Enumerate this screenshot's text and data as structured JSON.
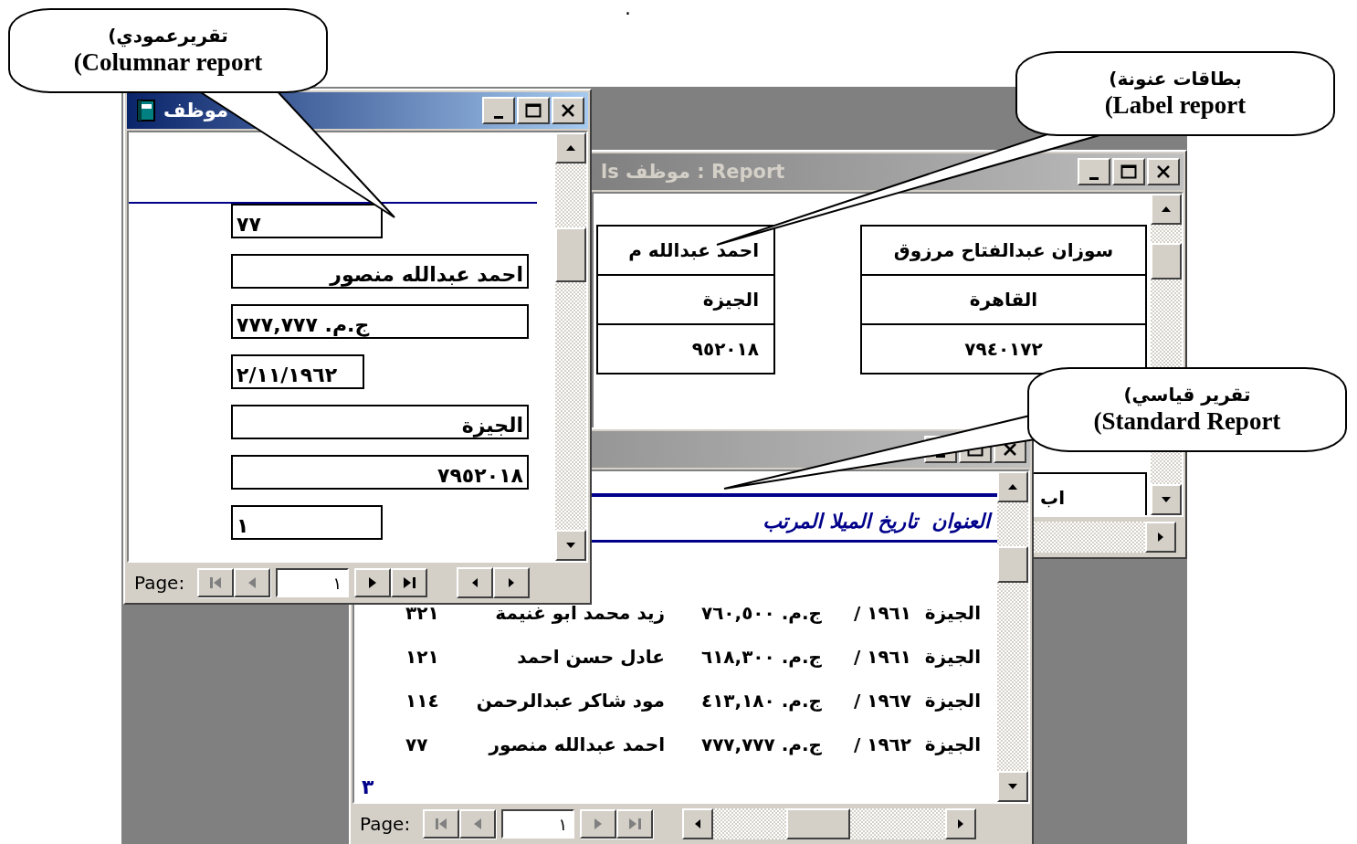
{
  "top_mark": ".",
  "callouts": [
    {
      "arabic": "(تقريرعمودي",
      "english": "(Columnar report"
    },
    {
      "arabic": "(بطاقات عنونة",
      "english": "(Label report"
    },
    {
      "arabic": "(تقرير قياسي",
      "english": "(Standard Report"
    }
  ],
  "columnar_report": {
    "title": "موظف",
    "fields": [
      "٧٧",
      "احمد عبدالله منصور",
      "ج.م. ٧٧٧,٧٧٧",
      "٢/١١/١٩٦٢",
      "الجيزة",
      "٧٩٥٢٠١٨",
      "١"
    ],
    "page_label": "Page:",
    "page_number": "١",
    "nav": [
      {
        "kind": "first",
        "disabled": true
      },
      {
        "kind": "previous",
        "disabled": true
      },
      {
        "kind": "next",
        "disabled": false
      },
      {
        "kind": "last",
        "disabled": false
      }
    ]
  },
  "label_report": {
    "title": "ls موظف : Report",
    "cards": [
      {
        "lines": [
          "سوزان عبدالفتاح مرزوق",
          "القاهرة",
          "٧٩٤٠١٧٢"
        ]
      },
      {
        "lines": [
          "احمد عبدالله م",
          "الجيزة",
          "٩٥٢٠١٨"
        ]
      },
      {
        "lines": [
          "اب"
        ]
      }
    ]
  },
  "standard_report": {
    "header": "العنوان  تاريخ الميلا المرتب",
    "rows": [
      {
        "cells": [
          "الجيزة",
          "١٩٦١ /",
          "ج.م. ٧٦٠,٥٠٠",
          "زيد محمد ابو غنيمة",
          "٣٢١"
        ]
      },
      {
        "cells": [
          "الجيزة",
          "١٩٦١ /",
          "ج.م. ٦١٨,٣٠٠",
          "عادل حسن احمد",
          "١٢١"
        ]
      },
      {
        "cells": [
          "الجيزة",
          "١٩٦٧ /",
          "ج.م. ٤١٣,١٨٠",
          "مود شاكر عبدالرحمن",
          "١١٤"
        ]
      },
      {
        "cells": [
          "الجيزة",
          "١٩٦٢ /",
          "ج.م. ٧٧٧,٧٧٧",
          "احمد عبدالله منصور",
          "٧٧"
        ]
      }
    ],
    "page_footer": "٣",
    "page_label": "Page:",
    "page_number": "١",
    "nav": [
      {
        "kind": "first",
        "disabled": true
      },
      {
        "kind": "previous",
        "disabled": true
      },
      {
        "kind": "next",
        "disabled": true
      },
      {
        "kind": "last",
        "disabled": true
      }
    ]
  }
}
